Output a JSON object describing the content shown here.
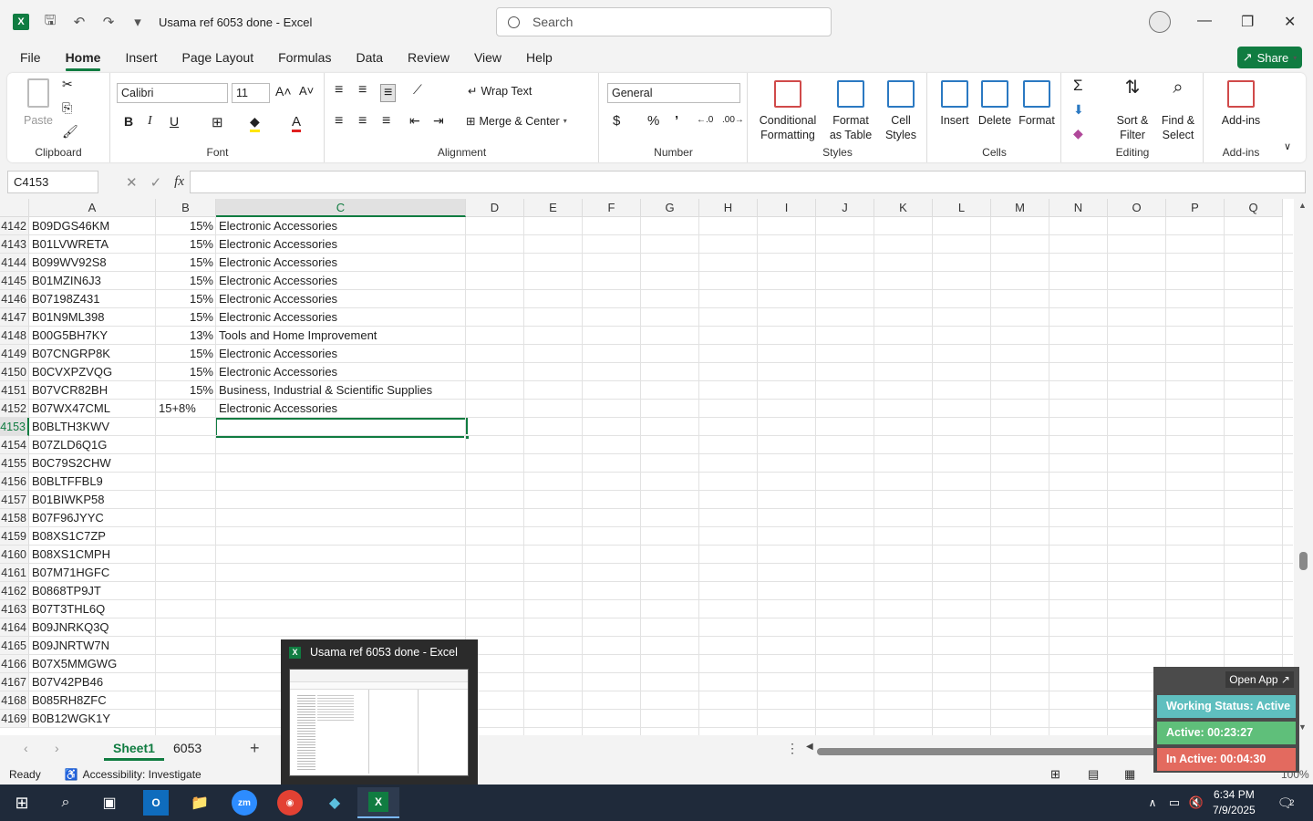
{
  "window": {
    "title": "Usama ref 6053 done  -  Excel",
    "search_placeholder": "Search"
  },
  "menu": {
    "tabs": [
      "File",
      "Home",
      "Insert",
      "Page Layout",
      "Formulas",
      "Data",
      "Review",
      "View",
      "Help"
    ],
    "share": "Share"
  },
  "ribbon": {
    "clipboard": {
      "paste": "Paste",
      "label": "Clipboard"
    },
    "font": {
      "name": "Calibri",
      "size": "11",
      "bold": "B",
      "italic": "I",
      "underline": "U",
      "label": "Font"
    },
    "alignment": {
      "wrap": "Wrap Text",
      "merge": "Merge & Center",
      "label": "Alignment"
    },
    "number": {
      "format": "General",
      "label": "Number"
    },
    "styles": {
      "conditional": "Conditional Formatting",
      "format_table": "Format as Table",
      "cell_styles": "Cell Styles",
      "label": "Styles"
    },
    "cells": {
      "insert": "Insert",
      "delete": "Delete",
      "format": "Format",
      "label": "Cells"
    },
    "editing": {
      "sort": "Sort & Filter",
      "find": "Find & Select",
      "label": "Editing"
    },
    "addins": {
      "addins": "Add-ins",
      "label": "Add-ins"
    }
  },
  "formula_bar": {
    "name_box": "C4153",
    "fx": "fx",
    "formula": ""
  },
  "columns": [
    "A",
    "B",
    "C",
    "D",
    "E",
    "F",
    "G",
    "H",
    "I",
    "J",
    "K",
    "L",
    "M",
    "N",
    "O",
    "P",
    "Q"
  ],
  "rows": [
    {
      "n": "4142",
      "a": "B09DGS46KM",
      "b": "15%",
      "c": "Electronic Accessories"
    },
    {
      "n": "4143",
      "a": "B01LVWRETA",
      "b": "15%",
      "c": "Electronic Accessories"
    },
    {
      "n": "4144",
      "a": "B099WV92S8",
      "b": "15%",
      "c": "Electronic Accessories"
    },
    {
      "n": "4145",
      "a": "B01MZIN6J3",
      "b": "15%",
      "c": "Electronic Accessories"
    },
    {
      "n": "4146",
      "a": "B07198Z431",
      "b": "15%",
      "c": "Electronic Accessories"
    },
    {
      "n": "4147",
      "a": "B01N9ML398",
      "b": "15%",
      "c": "Electronic Accessories"
    },
    {
      "n": "4148",
      "a": "B00G5BH7KY",
      "b": "13%",
      "c": "Tools and Home Improvement"
    },
    {
      "n": "4149",
      "a": "B07CNGRP8K",
      "b": "15%",
      "c": "Electronic Accessories"
    },
    {
      "n": "4150",
      "a": "B0CVXPZVQG",
      "b": "15%",
      "c": "Electronic Accessories"
    },
    {
      "n": "4151",
      "a": "B07VCR82BH",
      "b": "15%",
      "c": "Business, Industrial & Scientific Supplies"
    },
    {
      "n": "4152",
      "a": "B07WX47CML",
      "b": "15+8%",
      "c": "Electronic Accessories"
    },
    {
      "n": "4153",
      "a": "B0BLTH3KWV",
      "b": "",
      "c": ""
    },
    {
      "n": "4154",
      "a": "B07ZLD6Q1G",
      "b": "",
      "c": ""
    },
    {
      "n": "4155",
      "a": "B0C79S2CHW",
      "b": "",
      "c": ""
    },
    {
      "n": "4156",
      "a": "B0BLTFFBL9",
      "b": "",
      "c": ""
    },
    {
      "n": "4157",
      "a": "B01BIWKP58",
      "b": "",
      "c": ""
    },
    {
      "n": "4158",
      "a": "B07F96JYYC",
      "b": "",
      "c": ""
    },
    {
      "n": "4159",
      "a": "B08XS1C7ZP",
      "b": "",
      "c": ""
    },
    {
      "n": "4160",
      "a": "B08XS1CMPH",
      "b": "",
      "c": ""
    },
    {
      "n": "4161",
      "a": "B07M71HGFC",
      "b": "",
      "c": ""
    },
    {
      "n": "4162",
      "a": "B0868TP9JT",
      "b": "",
      "c": ""
    },
    {
      "n": "4163",
      "a": "B07T3THL6Q",
      "b": "",
      "c": ""
    },
    {
      "n": "4164",
      "a": "B09JNRKQ3Q",
      "b": "",
      "c": ""
    },
    {
      "n": "4165",
      "a": "B09JNRTW7N",
      "b": "",
      "c": ""
    },
    {
      "n": "4166",
      "a": "B07X5MMGWG",
      "b": "",
      "c": ""
    },
    {
      "n": "4167",
      "a": "B07V42PB46",
      "b": "",
      "c": ""
    },
    {
      "n": "4168",
      "a": "B085RH8ZFC",
      "b": "",
      "c": ""
    },
    {
      "n": "4169",
      "a": "B0B12WGK1Y",
      "b": "",
      "c": ""
    }
  ],
  "sheets": {
    "tabs": [
      "Sheet1",
      "6053"
    ],
    "active": "Sheet1"
  },
  "status": {
    "ready": "Ready",
    "accessibility": "Accessibility: Investigate",
    "zoom": "100%"
  },
  "thumbnail": {
    "title": "Usama ref 6053 done - Excel"
  },
  "tracker": {
    "open_app": "Open App ↗",
    "working_status": "Working Status: Active",
    "active": "Active: 00:23:27",
    "inactive": "In Active: 00:04:30",
    "colors": {
      "status": "#5fbfbf",
      "active": "#5fbf7a",
      "inactive": "#e36a5f"
    }
  },
  "taskbar": {
    "time": "6:34 PM",
    "date": "7/9/2025",
    "notifications": "2"
  },
  "colors": {
    "accent": "#107c41"
  }
}
